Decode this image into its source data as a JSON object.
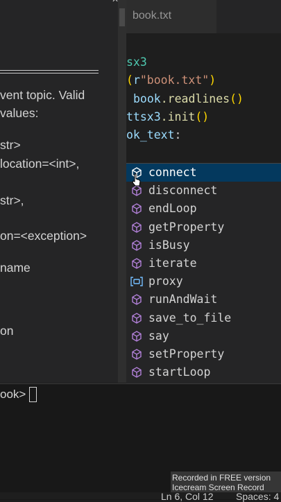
{
  "doc_panel": {
    "lines": [
      "vent topic. Valid",
      "values:",
      "str>",
      "location=<int>,",
      "str>,",
      "on=<exception>",
      "name",
      "on"
    ]
  },
  "editor": {
    "tab_label": "book.txt",
    "code": {
      "line1": "sx3",
      "line2_paren_open": "(",
      "line2_prefix": "r",
      "line2_str": "\"book.txt\"",
      "line2_paren_close": ")",
      "line3_var": "book",
      "line3_fn": ".readlines",
      "line3_parens": "()",
      "line4_cls": "ttsx3",
      "line4_fn": ".init",
      "line4_parens": "()",
      "line5_var": "ok_text",
      "line5_colon": ":"
    }
  },
  "suggestions": [
    {
      "label": "connect",
      "kind": "method"
    },
    {
      "label": "disconnect",
      "kind": "method"
    },
    {
      "label": "endLoop",
      "kind": "method"
    },
    {
      "label": "getProperty",
      "kind": "method"
    },
    {
      "label": "isBusy",
      "kind": "method"
    },
    {
      "label": "iterate",
      "kind": "method"
    },
    {
      "label": "proxy",
      "kind": "variable"
    },
    {
      "label": "runAndWait",
      "kind": "method"
    },
    {
      "label": "save_to_file",
      "kind": "method"
    },
    {
      "label": "say",
      "kind": "method"
    },
    {
      "label": "setProperty",
      "kind": "method"
    },
    {
      "label": "startLoop",
      "kind": "method"
    }
  ],
  "terminal": {
    "prompt": "ook>"
  },
  "watermark": {
    "line1": "Recorded in FREE version",
    "line2": "Icecream  Screen  Record"
  },
  "statusbar": {
    "position": "Ln 6, Col 12",
    "spaces": "Spaces: 4"
  },
  "colors": {
    "selected_bg": "#04395e",
    "method_icon": "#b180d7",
    "variable_icon": "#75beff"
  }
}
